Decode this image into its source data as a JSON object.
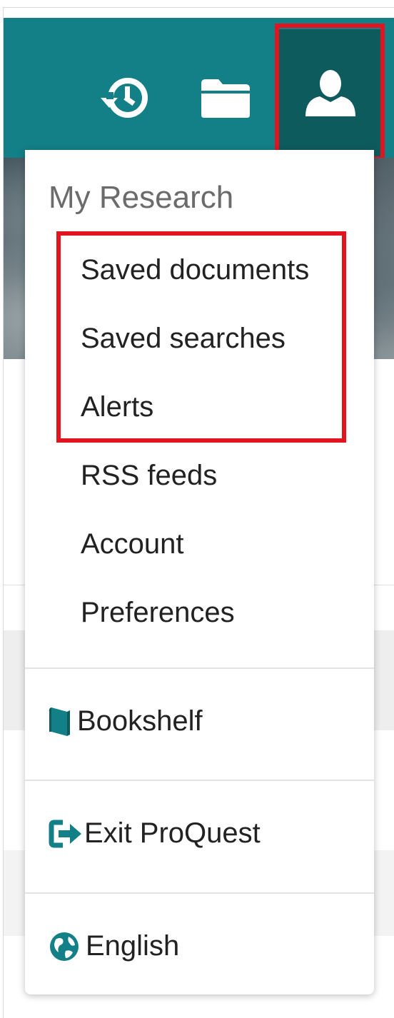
{
  "colors": {
    "toolbar": "#137f86",
    "active_button": "#0d5b5d",
    "highlight": "#e11420",
    "icon_teal": "#137f86"
  },
  "toolbar": {
    "icons": [
      "history-icon",
      "folder-icon",
      "user-icon"
    ]
  },
  "menu": {
    "heading": "My Research",
    "items": [
      {
        "label": "Saved documents"
      },
      {
        "label": "Saved searches"
      },
      {
        "label": "Alerts"
      },
      {
        "label": "RSS feeds"
      },
      {
        "label": "Account"
      },
      {
        "label": "Preferences"
      }
    ],
    "bookshelf": {
      "label": "Bookshelf",
      "icon": "book-icon"
    },
    "exit": {
      "label": "Exit ProQuest",
      "icon": "exit-icon"
    },
    "language": {
      "label": "English",
      "icon": "globe-icon"
    }
  }
}
